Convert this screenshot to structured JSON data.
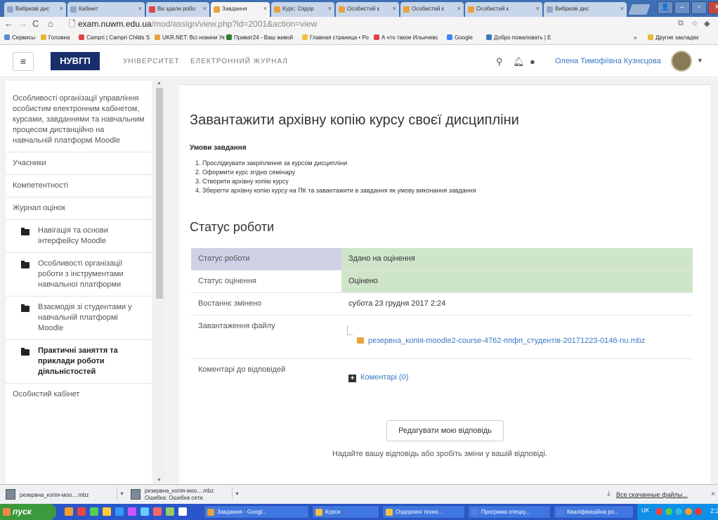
{
  "browser": {
    "tabs": [
      {
        "label": "Вибркові дис",
        "icon": "gray"
      },
      {
        "label": "Кабінет",
        "icon": "gray"
      },
      {
        "label": "Ви здали робо",
        "icon": "gmail"
      },
      {
        "label": "Завдання",
        "icon": "moodle"
      },
      {
        "label": "Курс: Оздор",
        "icon": "moodle"
      },
      {
        "label": "Особистий к",
        "icon": "moodle"
      },
      {
        "label": "Особистий к",
        "icon": "moodle"
      },
      {
        "label": "Особистий к",
        "icon": "moodle"
      },
      {
        "label": "Вибркові дис",
        "icon": "gray"
      }
    ],
    "active_tab_index": 3,
    "url_host": "exam.nuwm.edu.ua",
    "url_path": "/mod/assign/view.php?id=2001&action=view",
    "bookmarks": [
      {
        "label": "Сервисы",
        "color": "#5a8ad6"
      },
      {
        "label": "Головна",
        "color": "#e8b83a"
      },
      {
        "label": "Campri | Campri Childs S",
        "color": "#d44"
      },
      {
        "label": "UKR.NET: Всі новини Ук",
        "color": "#e8a33d"
      },
      {
        "label": "Приват24 - Ваш живой",
        "color": "#2e7d32"
      },
      {
        "label": "Главная страница • Ро",
        "color": "#f0c040"
      },
      {
        "label": "А что такое Ильичевс",
        "color": "#d44"
      },
      {
        "label": "Google",
        "color": "#4285f4"
      },
      {
        "label": "Добро пожаловать | E",
        "color": "#3a78c2"
      },
      {
        "label": "»",
        "color": ""
      },
      {
        "label": "Другие закладки",
        "color": "#e8b83a"
      }
    ]
  },
  "header": {
    "logo": "НУВГП",
    "university": "УНІВЕРСИТЕТ",
    "journal": "ЕЛЕКТРОННИЙ ЖУРНАЛ",
    "user_name": "Олена Тимофіївна Кузнєцова"
  },
  "sidebar": {
    "items": [
      {
        "label": "Особливості організації управління особистим електронним кабінетом, курсами, завданнями та навчальним процесом дистанційно на навчальній платформі Moodle",
        "type": "text"
      },
      {
        "label": "Учасники",
        "type": "text"
      },
      {
        "label": "Компетентності",
        "type": "text"
      },
      {
        "label": "Журнал оцінок",
        "type": "text"
      },
      {
        "label": "Навігація та основи інтерфейсу Moodle",
        "type": "folder"
      },
      {
        "label": "Особливості організації роботи з інструментами навчальної платформи",
        "type": "folder"
      },
      {
        "label": "Взаємодія зі студентами у навчальній платформі Moodle",
        "type": "folder"
      },
      {
        "label": "Практичні заняття та приклади роботи діяльністостей",
        "type": "folder-bold"
      },
      {
        "label": "Особистий кабінет",
        "type": "text"
      }
    ]
  },
  "main": {
    "title": "Завантажити архівну копію курсу своєї дисципліни",
    "conditions_heading": "Умови завдання",
    "conditions": [
      "1. Прослідкувати закріплення за курсом дисципліни",
      "2. Оформити курс згідно семінару",
      "3. Створити архівну копію курсу",
      "4. Зберегти архівну копію курсу на ПК та завантажити в завдання як умову виконання завдання"
    ],
    "status_heading": "Статус роботи",
    "status_rows": [
      {
        "key": "Статус роботи",
        "value": "Здано на оцінення"
      },
      {
        "key": "Статус оцінення",
        "value": "Оцінено"
      },
      {
        "key": "Востаннє змінено",
        "value": "субота 23 грудня 2017 2:24"
      },
      {
        "key": "Завантаження файлу",
        "value": "резервна_копія-moodle2-course-4762-ппфп_студентів-20171223-0146-nu.mbz"
      },
      {
        "key": "Коментарі до відповідей",
        "value": "Коментарі (0)"
      }
    ],
    "edit_button": "Редагувати мою відповідь",
    "hint": "Надайте вашу відповідь або зробіть зміни у вашій відповіді."
  },
  "downloads": {
    "items": [
      {
        "name": "резервна_копія-моо....mbz",
        "status": ""
      },
      {
        "name": "резервна_копія-моо....mbz",
        "status": "Ошибка: Ошибка сети."
      }
    ],
    "show_all": "Все скачанные файлы..."
  },
  "taskbar": {
    "start": "пуск",
    "tasks": [
      "Завдання - Googl...",
      "Курси",
      "Оздоровчі техно...",
      "Програма спецку...",
      "Кваліфікаційна ро..."
    ],
    "lang": "UK",
    "clock": "2:25"
  },
  "colors": {
    "status_key_bg": "#cfd0e6",
    "status_value_bg": "#cfe5c9",
    "link": "#3a78c2",
    "logo_bg": "#1a2e6b",
    "taskbar": "#2a56c9"
  }
}
